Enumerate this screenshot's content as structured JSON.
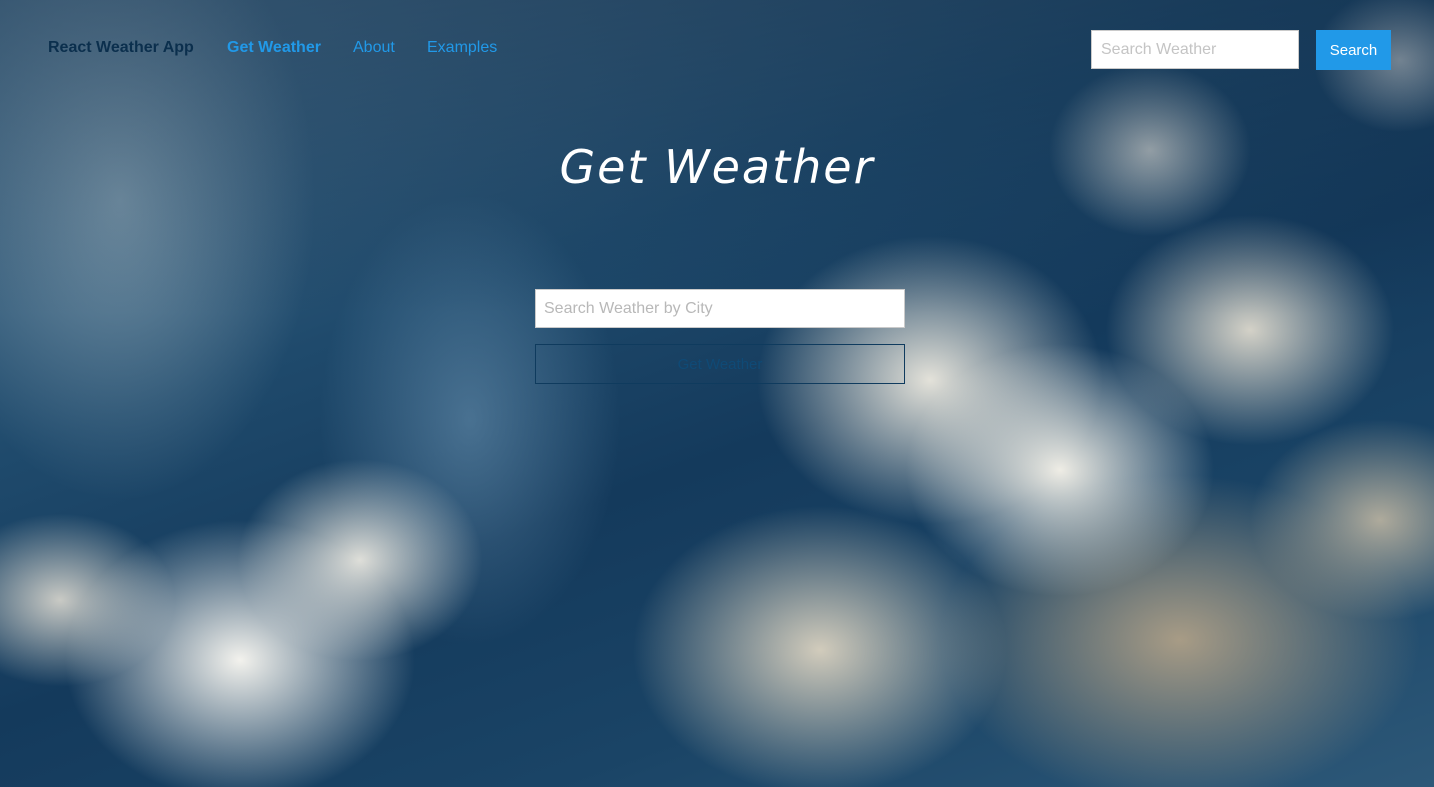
{
  "nav": {
    "brand": "React Weather App",
    "links": [
      {
        "label": "Get Weather",
        "active": true
      },
      {
        "label": "About",
        "active": false
      },
      {
        "label": "Examples",
        "active": false
      }
    ],
    "search": {
      "placeholder": "Search Weather",
      "button_label": "Search"
    }
  },
  "main": {
    "title": "Get Weather",
    "city_input_placeholder": "Search Weather by City",
    "submit_label": "Get Weather"
  },
  "colors": {
    "accent": "#2199e8",
    "brand_text": "#0b2f4d",
    "title_text": "#ffffff"
  }
}
